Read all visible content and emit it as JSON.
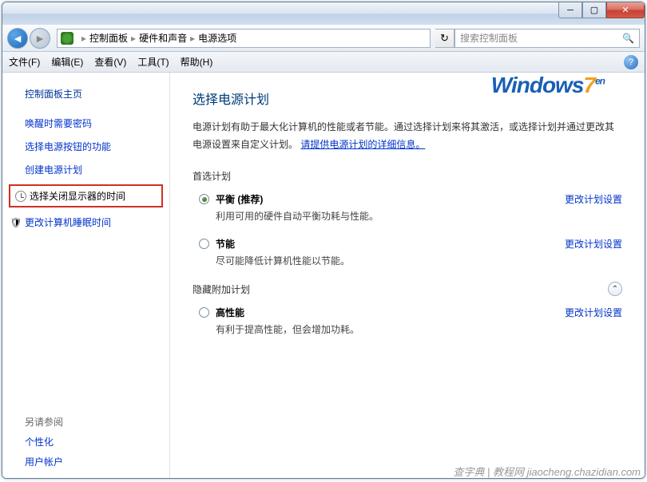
{
  "titlebar": {},
  "nav": {
    "breadcrumb": [
      "控制面板",
      "硬件和声音",
      "电源选项"
    ],
    "search_placeholder": "搜索控制面板"
  },
  "menu": {
    "file": "文件(F)",
    "edit": "编辑(E)",
    "view": "查看(V)",
    "tools": "工具(T)",
    "help": "帮助(H)"
  },
  "sidebar": {
    "home": "控制面板主页",
    "links": [
      "唤醒时需要密码",
      "选择电源按钮的功能",
      "创建电源计划"
    ],
    "highlighted": "选择关闭显示器的时间",
    "sleep_link": "更改计算机睡眠时间",
    "see_also": "另请参阅",
    "footer_links": [
      "个性化",
      "用户帐户"
    ]
  },
  "main": {
    "title": "选择电源计划",
    "desc_prefix": "电源计划有助于最大化计算机的性能或者节能。通过选择计划来将其激活，或选择计划并通过更改其电源设置来自定义计划。",
    "desc_link": "请提供电源计划的详细信息。",
    "preferred_title": "首选计划",
    "hidden_title": "隐藏附加计划",
    "change_label": "更改计划设置",
    "plans": {
      "balanced": {
        "name": "平衡 (推荐)",
        "desc": "利用可用的硬件自动平衡功耗与性能。"
      },
      "saver": {
        "name": "节能",
        "desc": "尽可能降低计算机性能以节能。"
      },
      "high": {
        "name": "高性能",
        "desc": "有利于提高性能，但会增加功耗。"
      }
    }
  },
  "watermark": {
    "logo_part1": "Windows",
    "logo_part2": "7",
    "logo_suffix": "en",
    "bottom": "查字典 | 教程网  jiaocheng.chazidian.com"
  }
}
